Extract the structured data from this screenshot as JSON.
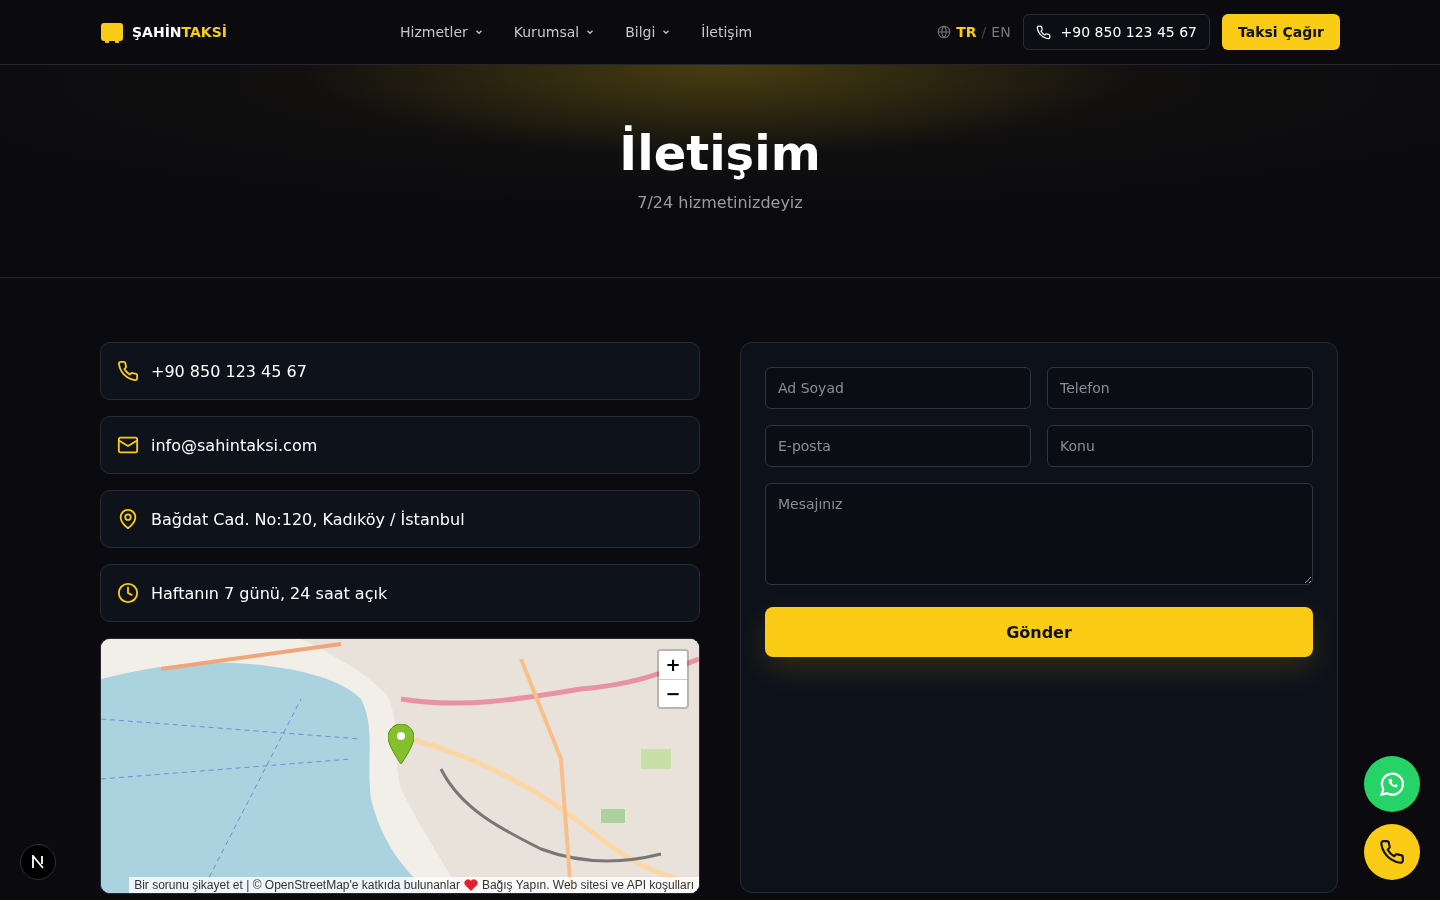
{
  "header": {
    "logo": {
      "first": "ŞAHİN",
      "second": "TAKSİ"
    },
    "nav": [
      {
        "label": "Hizmetler",
        "dropdown": true
      },
      {
        "label": "Kurumsal",
        "dropdown": true
      },
      {
        "label": "Bilgi",
        "dropdown": true
      },
      {
        "label": "İletişim",
        "dropdown": false
      }
    ],
    "languages": [
      {
        "label": "TR",
        "selected": true
      },
      {
        "label": "EN",
        "selected": false
      }
    ],
    "language_separator": "/",
    "phone": "+90 850 123 45 67",
    "cta": "Taksi Çağır"
  },
  "hero": {
    "title": "İletişim",
    "subtitle": "7/24 hizmetinizdeyiz"
  },
  "contact_items": [
    {
      "kind": "phone",
      "text": "+90 850 123 45 67"
    },
    {
      "kind": "email",
      "text": "info@sahintaksi.com"
    },
    {
      "kind": "location",
      "text": "Bağdat Cad. No:120, Kadıköy / İstanbul"
    },
    {
      "kind": "clock",
      "text": "Haftanın 7 günü, 24 saat açık"
    }
  ],
  "map": {
    "zoom_in": "+",
    "zoom_out": "−",
    "attribution": [
      "Bir sorunu şikayet et | © OpenStreetMap'e katkıda bulunanlar",
      "Bağış Yapın. Web sitesi ve API koşulları"
    ]
  },
  "form": {
    "fields": [
      {
        "placeholder": "Ad Soyad"
      },
      {
        "placeholder": "Telefon"
      },
      {
        "placeholder": "E-posta"
      },
      {
        "placeholder": "Konu"
      }
    ],
    "message_placeholder": "Mesajınız",
    "submit": "Gönder"
  }
}
